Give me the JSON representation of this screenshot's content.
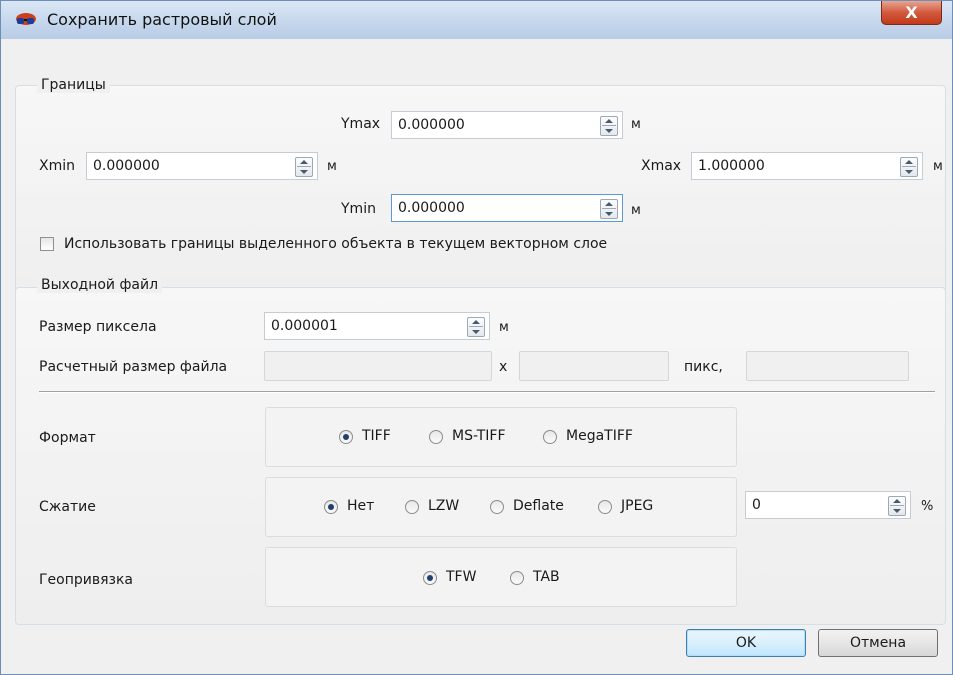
{
  "window": {
    "title": "Сохранить растровый слой",
    "close_label": "X"
  },
  "bounds": {
    "group_title": "Границы",
    "ymax_label": "Ymax",
    "ymax_value": "0.000000",
    "xmin_label": "Xmin",
    "xmin_value": "0.000000",
    "xmax_label": "Xmax",
    "xmax_value": "1.000000",
    "ymin_label": "Ymin",
    "ymin_value": "0.000000",
    "unit": "м",
    "use_selected_label": "Использовать границы выделенного объекта в текущем векторном слое",
    "use_selected_checked": false
  },
  "output": {
    "group_title": "Выходной файл",
    "pixel_size_label": "Размер пиксела",
    "pixel_size_value": "0.000001",
    "pixel_size_unit": "м",
    "est_size_label": "Расчетный размер файла",
    "x_label": "x",
    "pix_label": "пикс,",
    "format_label": "Формат",
    "format_options": [
      "TIFF",
      "MS-TIFF",
      "MegaTIFF"
    ],
    "format_selected": "TIFF",
    "compression_label": "Сжатие",
    "compression_options": [
      "Нет",
      "LZW",
      "Deflate",
      "JPEG"
    ],
    "compression_selected": "Нет",
    "quality_value": "0",
    "quality_unit": "%",
    "georef_label": "Геопривязка",
    "georef_options": [
      "TFW",
      "TAB"
    ],
    "georef_selected": "TFW"
  },
  "buttons": {
    "ok": "OK",
    "cancel": "Отмена"
  }
}
